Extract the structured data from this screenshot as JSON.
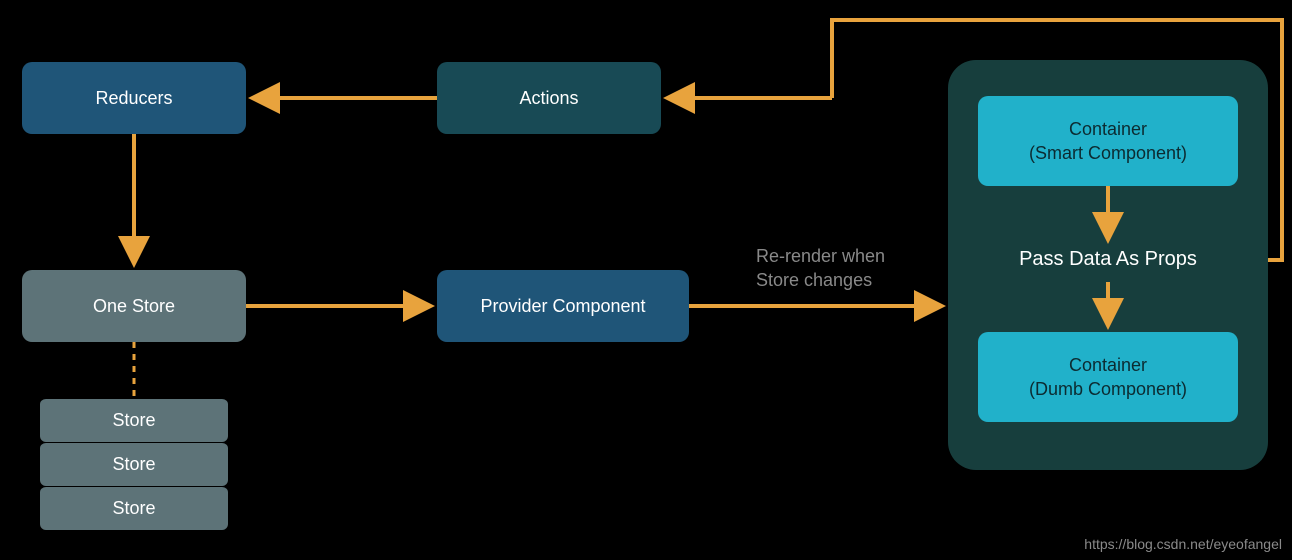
{
  "nodes": {
    "reducers": "Reducers",
    "actions": "Actions",
    "one_store": "One Store",
    "provider": "Provider Component",
    "store1": "Store",
    "store2": "Store",
    "store3": "Store",
    "smart_line1": "Container",
    "smart_line2": "(Smart Component)",
    "dumb_line1": "Container",
    "dumb_line2": "(Dumb Component)",
    "panel_text": "Pass Data As Props"
  },
  "edges": {
    "rerender": "Re-render when\nStore changes"
  },
  "watermark": "https://blog.csdn.net/eyeofangel",
  "colors": {
    "arrow": "#e8a33d",
    "dash": "#e8a33d"
  }
}
